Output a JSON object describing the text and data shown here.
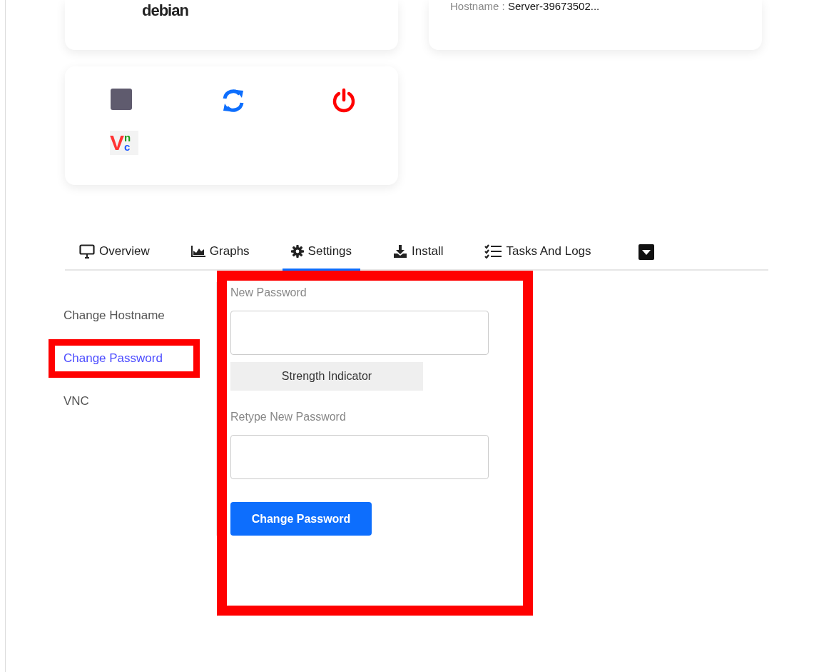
{
  "os_card": {
    "logo": "debian"
  },
  "info_card": {
    "hostname_label": "Hostname :",
    "hostname_value": "Server-39673502..."
  },
  "actions": [
    {
      "kind": "stop"
    },
    {
      "kind": "restart"
    },
    {
      "kind": "power"
    },
    {
      "kind": "vnc",
      "logo": "Vnc"
    }
  ],
  "tabs": [
    {
      "kind": "monitor",
      "label": "Overview",
      "selected": false
    },
    {
      "kind": "chart",
      "label": "Graphs",
      "selected": false
    },
    {
      "kind": "gear",
      "label": "Settings",
      "selected": true
    },
    {
      "kind": "download",
      "label": "Install",
      "selected": false
    },
    {
      "kind": "checklist",
      "label": "Tasks And Logs",
      "selected": false
    },
    {
      "kind": "dropdown",
      "selected": false
    }
  ],
  "settings_menu": [
    {
      "label": "Change Hostname",
      "selected": false,
      "highlighted": false
    },
    {
      "label": "Change Password",
      "selected": true,
      "highlighted": true
    },
    {
      "label": "VNC",
      "selected": false,
      "highlighted": false
    }
  ],
  "password_form": {
    "highlighted": true,
    "new_label": "New Password",
    "strength": "Strength Indicator",
    "retype_label": "Retype New Password",
    "submit": "Change Password"
  }
}
